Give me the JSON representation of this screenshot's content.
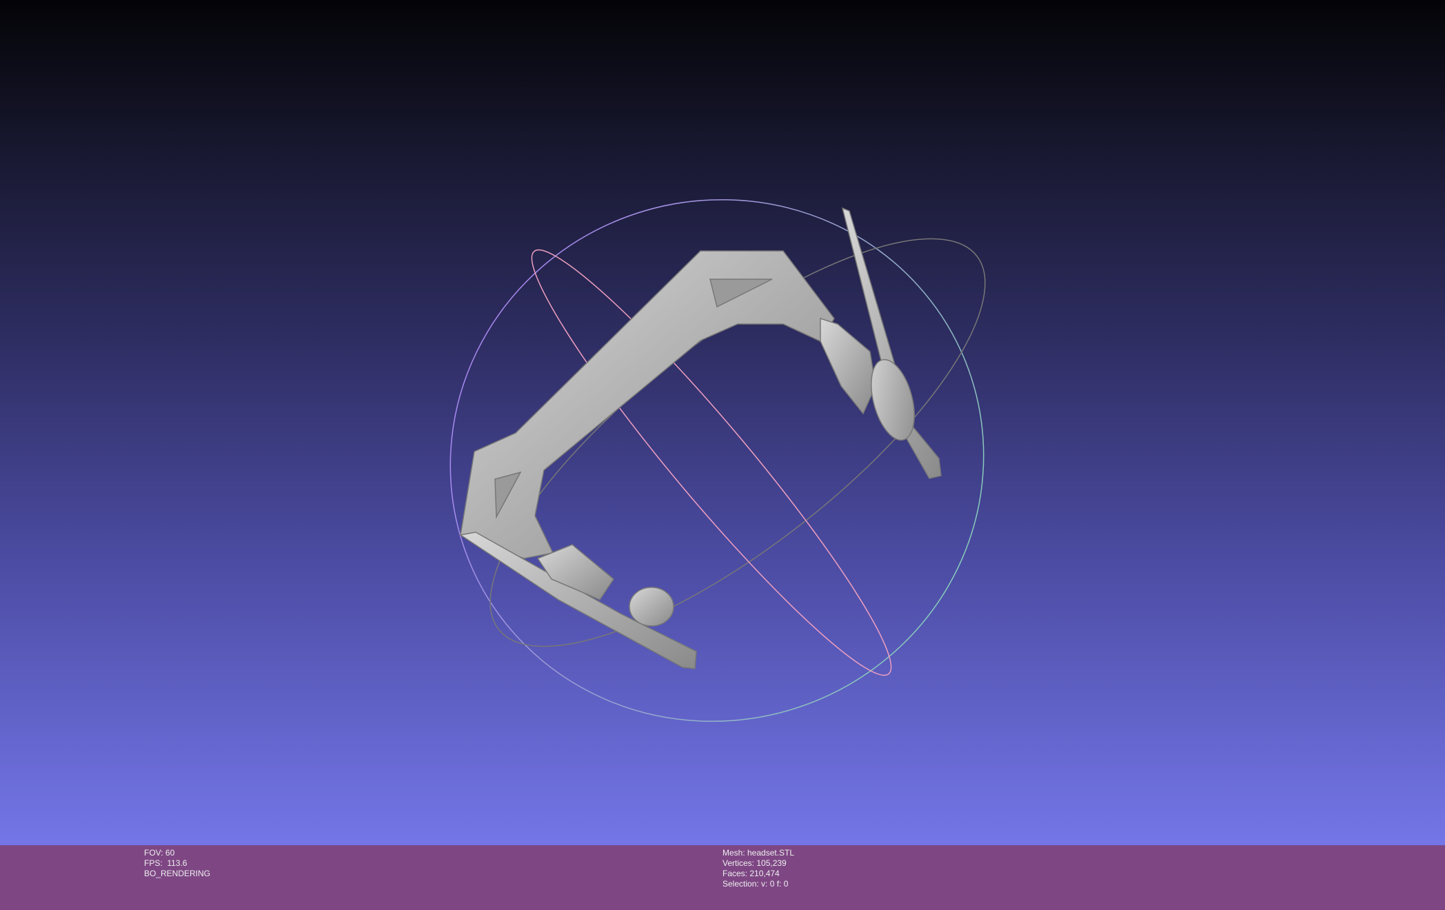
{
  "left_info": {
    "fov": "FOV: 60",
    "fps": "FPS:  113.6",
    "mode": "BO_RENDERING"
  },
  "right_info": {
    "mesh": "Mesh: headset.STL",
    "vertices": "Vertices: 105,239",
    "faces": "Faces: 210,474",
    "selection": "Selection: v: 0 f: 0"
  },
  "colors": {
    "statusbar": "#7e4784",
    "bg_bottom": "#7476e8",
    "bg_top": "#040407",
    "mesh": "#b8b8b8"
  }
}
